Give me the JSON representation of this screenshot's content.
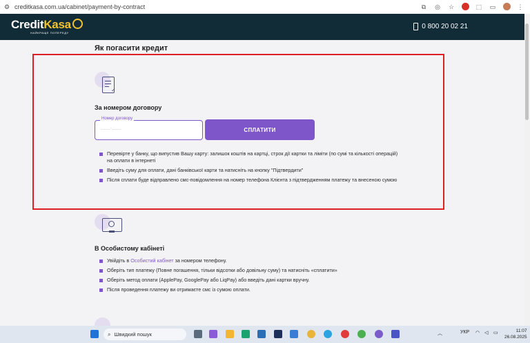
{
  "browser": {
    "url": "creditkasa.com.ua/cabinet/payment-by-contract",
    "icons": [
      "translate-icon",
      "eye-off-icon",
      "star-icon",
      "extensions-icon",
      "window-icon",
      "profile-avatar",
      "menu-icon"
    ]
  },
  "header": {
    "logo_credit": "Credit",
    "logo_kasa": "Kasa",
    "tagline": "НАЙКРАЩЕ ПОПЕРЕДУ",
    "phone": "0 800 20 02 21",
    "bg_color": "#112b37",
    "accent_color": "#f2c230"
  },
  "main": {
    "title": "Як погасити кредит",
    "contract_section": {
      "title": "За номером договору",
      "input_label": "Номер договору",
      "input_placeholder": "_____-_____",
      "button_label": "СПЛАТИТИ",
      "items": [
        "Перевірте у банку, що випустив Вашу карту: залишок коштів на картці, строк дії картки та ліміти (по сумі та кількості операцій) на оплати в інтернеті",
        "Введіть суму для оплати, дані банківської карти та натисніть на кнопку \"Підтвердити\"",
        "Після сплати буде відправлено смс-повідомлення на номер телефона Клієнта з підтвердженням платежу та внесеною сумою"
      ]
    },
    "cabinet_section": {
      "title": "В Особистому кабінеті",
      "item1_before": "Увійдіть в ",
      "item1_link": "Особистий кабінет",
      "item1_after": " за номером телефону.",
      "items": [
        "Оберіть тип платежу (Повне погашення, тільки відсотки або довільну суму) та натисніть «сплатити»",
        "Оберіть метод оплати (ApplePay, GooglePay або LiqPay) або введіть дані картки вручну.",
        "Після проведення платежу ви отримаєте смс із сумою оплати."
      ]
    },
    "accent_color": "#7f56c9",
    "highlight_color": "#e01e24"
  },
  "taskbar": {
    "search_placeholder": "Швидкий пошук",
    "lang": "УКР",
    "time": "11:07",
    "date": "26.08.2025"
  }
}
